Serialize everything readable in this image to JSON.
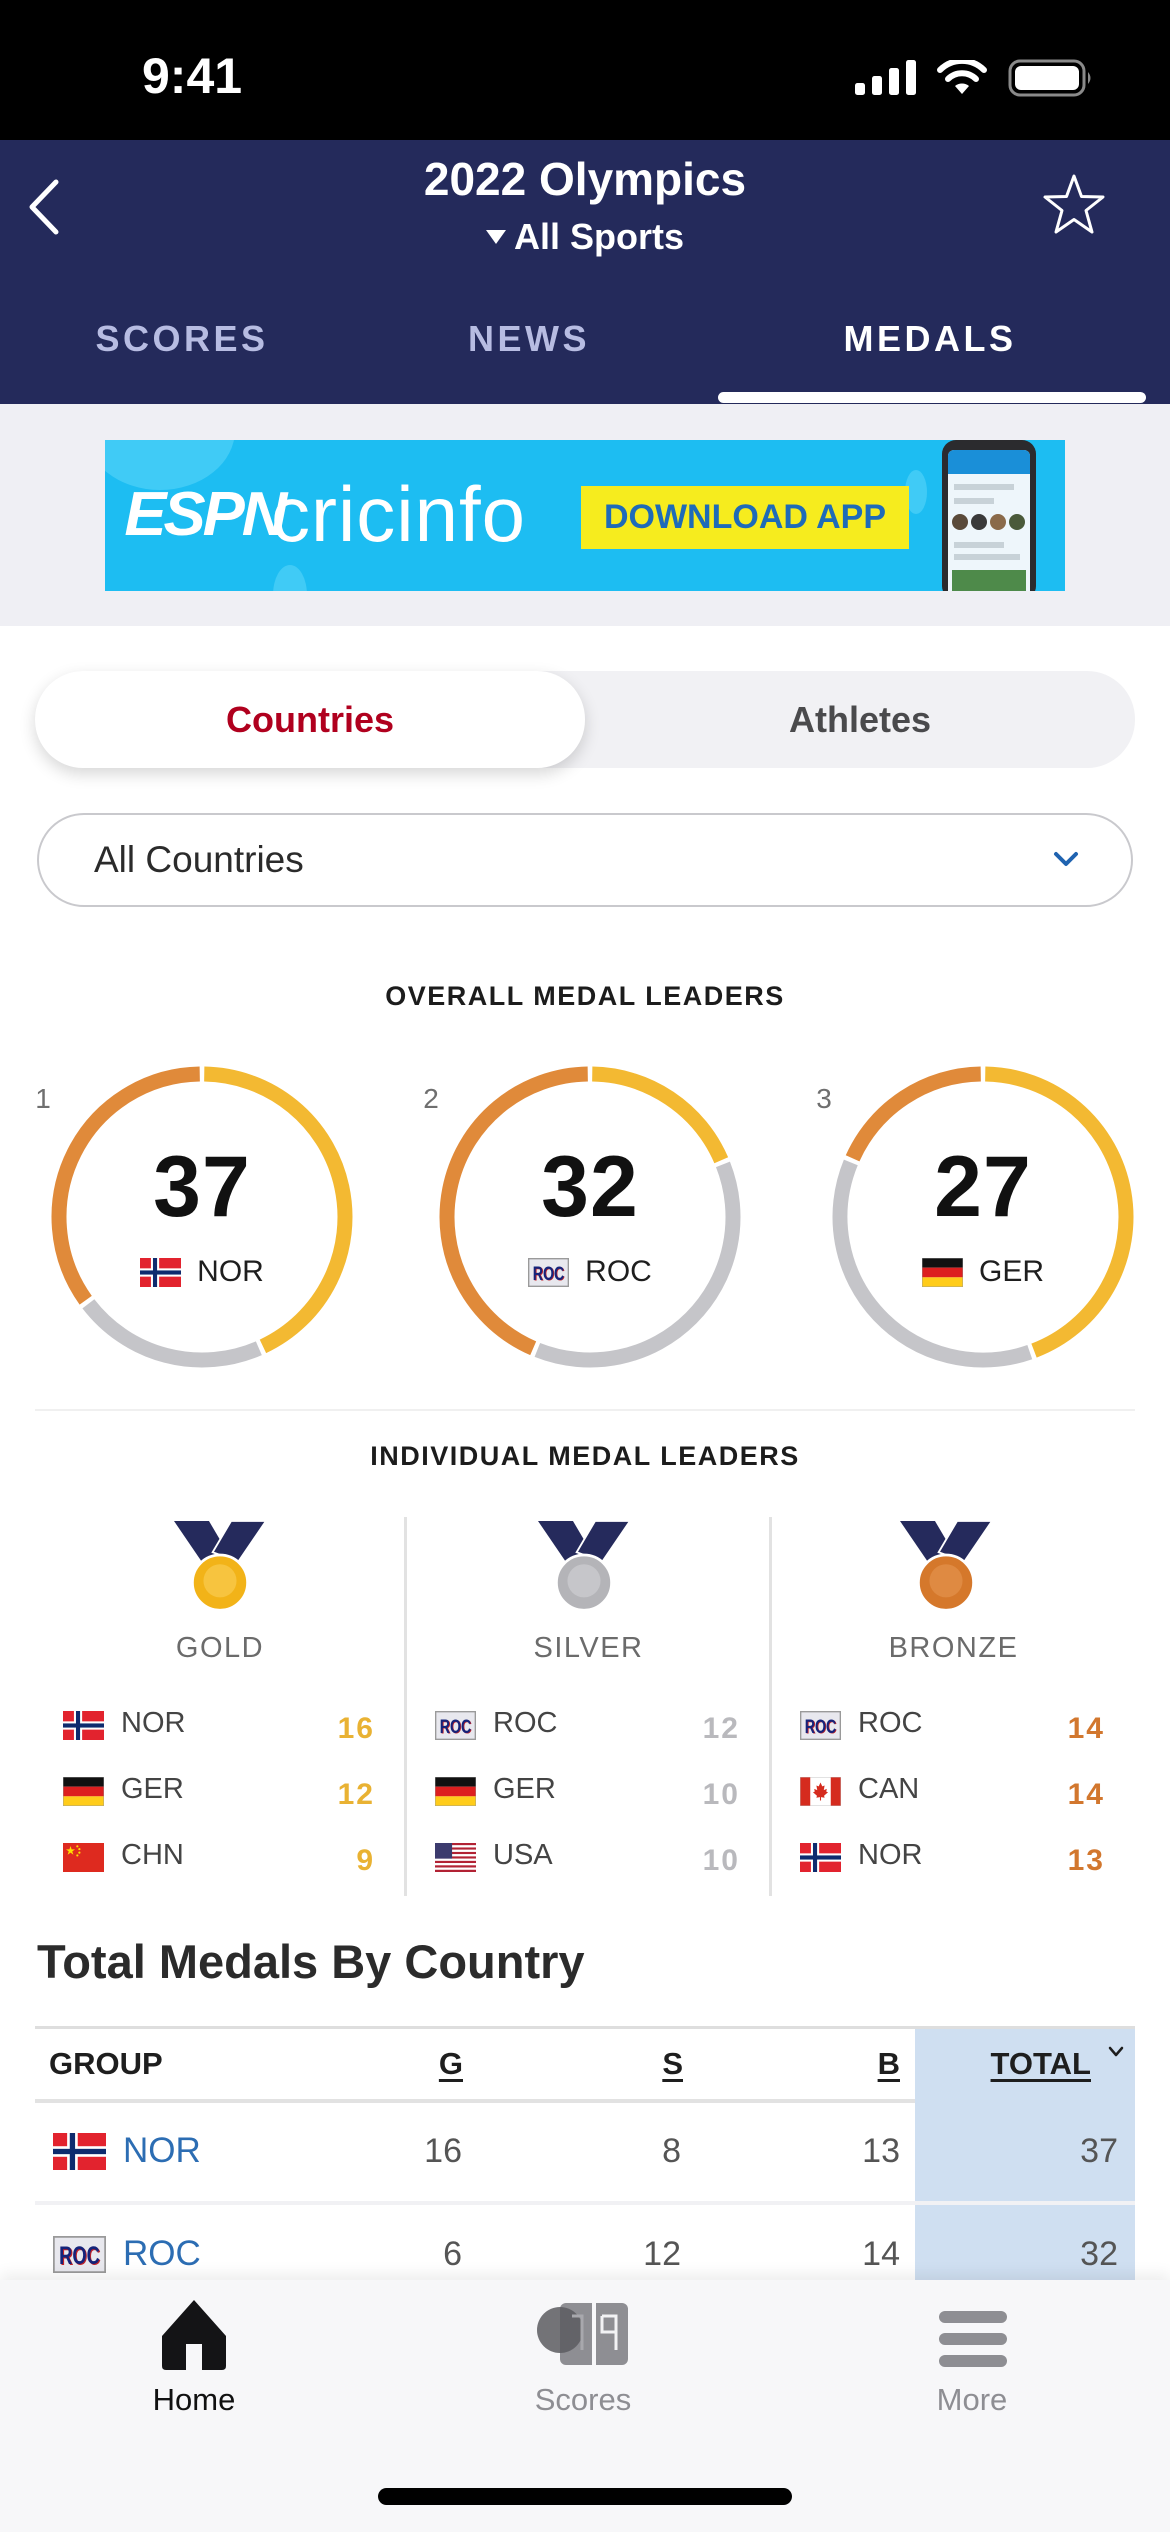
{
  "status_bar": {
    "time": "9:41"
  },
  "header": {
    "title": "2022 Olympics",
    "sport_filter": "All Sports"
  },
  "tabs": [
    {
      "label": "SCORES",
      "active": false
    },
    {
      "label": "NEWS",
      "active": false
    },
    {
      "label": "MEDALS",
      "active": true
    }
  ],
  "ad": {
    "brand_logo": "ESPN",
    "brand_name": "cricinfo",
    "cta": "DOWNLOAD APP"
  },
  "view_toggle": {
    "options": [
      {
        "label": "Countries",
        "active": true
      },
      {
        "label": "Athletes",
        "active": false
      }
    ]
  },
  "country_filter": {
    "value": "All Countries"
  },
  "overall": {
    "title": "OVERALL MEDAL LEADERS",
    "leaders": [
      {
        "rank": 1,
        "country": "NOR",
        "total": 37,
        "gold": 16,
        "silver": 8,
        "bronze": 13
      },
      {
        "rank": 2,
        "country": "ROC",
        "total": 32,
        "gold": 6,
        "silver": 12,
        "bronze": 14
      },
      {
        "rank": 3,
        "country": "GER",
        "total": 27,
        "gold": 12,
        "silver": 10,
        "bronze": 5
      }
    ]
  },
  "individual": {
    "title": "INDIVIDUAL MEDAL LEADERS",
    "columns": [
      {
        "label": "GOLD",
        "medal": "gold",
        "rows": [
          {
            "country": "NOR",
            "count": 16
          },
          {
            "country": "GER",
            "count": 12
          },
          {
            "country": "CHN",
            "count": 9
          }
        ]
      },
      {
        "label": "SILVER",
        "medal": "silver",
        "rows": [
          {
            "country": "ROC",
            "count": 12
          },
          {
            "country": "GER",
            "count": 10
          },
          {
            "country": "USA",
            "count": 10
          }
        ]
      },
      {
        "label": "BRONZE",
        "medal": "bronze",
        "rows": [
          {
            "country": "ROC",
            "count": 14
          },
          {
            "country": "CAN",
            "count": 14
          },
          {
            "country": "NOR",
            "count": 13
          }
        ]
      }
    ]
  },
  "table": {
    "title": "Total Medals By Country",
    "headers": {
      "group": "GROUP",
      "gold": "G",
      "silver": "S",
      "bronze": "B",
      "total": "TOTAL"
    },
    "sort": {
      "column": "total",
      "direction": "desc"
    },
    "rows": [
      {
        "country": "NOR",
        "gold": 16,
        "silver": 8,
        "bronze": 13,
        "total": 37
      },
      {
        "country": "ROC",
        "gold": 6,
        "silver": 12,
        "bronze": 14,
        "total": 32
      }
    ]
  },
  "tab_bar": {
    "items": [
      {
        "label": "Home",
        "icon": "home-icon",
        "active": true
      },
      {
        "label": "Scores",
        "icon": "scores-icon",
        "active": false
      },
      {
        "label": "More",
        "icon": "menu-icon",
        "active": false
      }
    ]
  },
  "colors": {
    "navy": "#242a5b",
    "gold": "#f3b932",
    "silver": "#c5c5c9",
    "bronze": "#e08a3a",
    "accent_red": "#b0001e",
    "link_blue": "#2c6db3",
    "total_column": "#cfdff1"
  }
}
